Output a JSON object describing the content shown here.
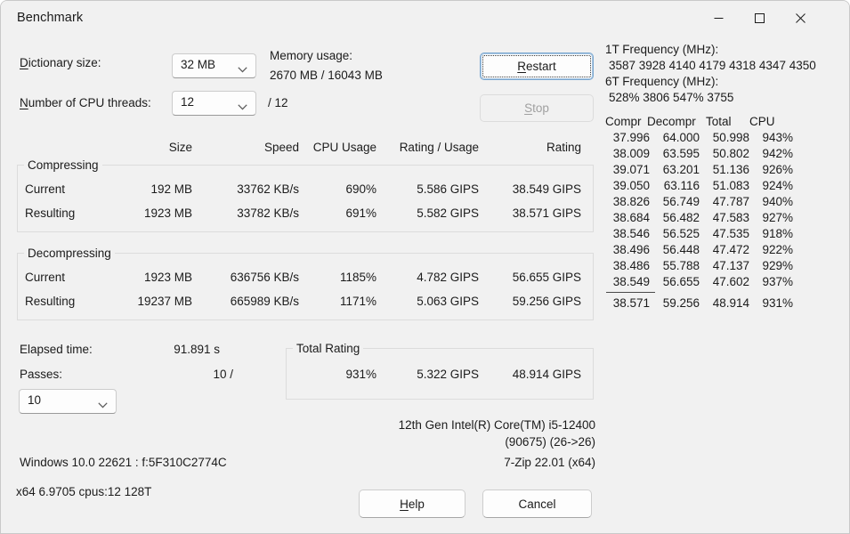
{
  "window": {
    "title": "Benchmark",
    "controls": {
      "minimize": "minimize-icon",
      "maximize": "maximize-icon",
      "close": "close-icon"
    }
  },
  "settings": {
    "dictionary_label": "Dictionary size:",
    "dictionary_value": "32 MB",
    "threads_label": "Number of CPU threads:",
    "threads_value": "12",
    "threads_total": "/ 12",
    "memory_label": "Memory usage:",
    "memory_value": "2670 MB / 16043 MB"
  },
  "actions": {
    "restart": "Restart",
    "stop": "Stop",
    "help": "Help",
    "cancel": "Cancel"
  },
  "results": {
    "headers": [
      "Size",
      "Speed",
      "CPU Usage",
      "Rating / Usage",
      "Rating"
    ],
    "compressing": {
      "title": "Compressing",
      "rows": [
        {
          "label": "Current",
          "size": "192 MB",
          "speed": "33762 KB/s",
          "cpu": "690%",
          "rating_usage": "5.586 GIPS",
          "rating": "38.549 GIPS"
        },
        {
          "label": "Resulting",
          "size": "1923 MB",
          "speed": "33782 KB/s",
          "cpu": "691%",
          "rating_usage": "5.582 GIPS",
          "rating": "38.571 GIPS"
        }
      ]
    },
    "decompressing": {
      "title": "Decompressing",
      "rows": [
        {
          "label": "Current",
          "size": "1923 MB",
          "speed": "636756 KB/s",
          "cpu": "1185%",
          "rating_usage": "4.782 GIPS",
          "rating": "56.655 GIPS"
        },
        {
          "label": "Resulting",
          "size": "19237 MB",
          "speed": "665989 KB/s",
          "cpu": "1171%",
          "rating_usage": "5.063 GIPS",
          "rating": "59.256 GIPS"
        }
      ]
    }
  },
  "summary": {
    "elapsed_label": "Elapsed time:",
    "elapsed_value": "91.891 s",
    "passes_label": "Passes:",
    "passes_value": "10 /",
    "passes_select": "10",
    "total_rating_title": "Total Rating",
    "total_cpu": "931%",
    "total_rating_usage": "5.322 GIPS",
    "total_rating": "48.914 GIPS"
  },
  "log": {
    "freq_1t_label": "1T Frequency (MHz):",
    "freq_1t_values": "3587 3928 4140 4179 4318 4347 4350",
    "freq_6t_label": "6T Frequency (MHz):",
    "freq_6t_values": "528% 3806 547% 3755",
    "columns": [
      "Compr",
      "Decompr",
      "Total",
      "CPU"
    ],
    "rows": [
      {
        "compr": "37.996",
        "decompr": "64.000",
        "total": "50.998",
        "cpu": "943%"
      },
      {
        "compr": "38.009",
        "decompr": "63.595",
        "total": "50.802",
        "cpu": "942%"
      },
      {
        "compr": "39.071",
        "decompr": "63.201",
        "total": "51.136",
        "cpu": "926%"
      },
      {
        "compr": "39.050",
        "decompr": "63.116",
        "total": "51.083",
        "cpu": "924%"
      },
      {
        "compr": "38.826",
        "decompr": "56.749",
        "total": "47.787",
        "cpu": "940%"
      },
      {
        "compr": "38.684",
        "decompr": "56.482",
        "total": "47.583",
        "cpu": "927%"
      },
      {
        "compr": "38.546",
        "decompr": "56.525",
        "total": "47.535",
        "cpu": "918%"
      },
      {
        "compr": "38.496",
        "decompr": "56.448",
        "total": "47.472",
        "cpu": "922%"
      },
      {
        "compr": "38.486",
        "decompr": "55.788",
        "total": "47.137",
        "cpu": "929%"
      },
      {
        "compr": "38.549",
        "decompr": "56.655",
        "total": "47.602",
        "cpu": "937%"
      }
    ],
    "totals": {
      "compr": "38.571",
      "decompr": "59.256",
      "total": "48.914",
      "cpu": "931%"
    }
  },
  "footer": {
    "cpu_name": "12th Gen Intel(R) Core(TM) i5-12400",
    "cpu_detail": "(90675) (26->26)",
    "os_info": "Windows 10.0 22621 : f:5F310C2774C",
    "app_version": "7-Zip 22.01 (x64)",
    "build_info": "x64 6.9705 cpus:12 128T"
  }
}
